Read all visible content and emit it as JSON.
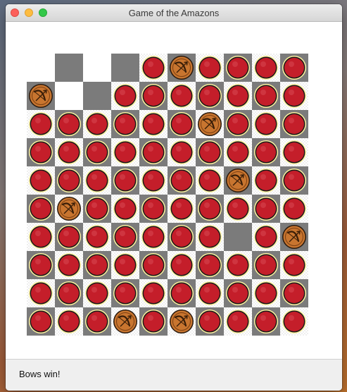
{
  "window": {
    "title": "Game of the Amazons"
  },
  "status": {
    "text": "Bows win!"
  },
  "board": {
    "size": 10,
    "legend": {
      "E": "empty",
      "A": "arrow-token",
      "B": "bow-piece"
    },
    "grid": [
      [
        "E",
        "E",
        "E",
        "E",
        "A",
        "B",
        "A",
        "A",
        "A",
        "A"
      ],
      [
        "B",
        "E",
        "E",
        "A",
        "A",
        "A",
        "A",
        "A",
        "A",
        "A"
      ],
      [
        "A",
        "A",
        "A",
        "A",
        "A",
        "A",
        "B",
        "A",
        "A",
        "A"
      ],
      [
        "A",
        "A",
        "A",
        "A",
        "A",
        "A",
        "A",
        "A",
        "A",
        "A"
      ],
      [
        "A",
        "A",
        "A",
        "A",
        "A",
        "A",
        "A",
        "B",
        "A",
        "A"
      ],
      [
        "A",
        "B",
        "A",
        "A",
        "A",
        "A",
        "A",
        "A",
        "A",
        "A"
      ],
      [
        "A",
        "A",
        "A",
        "A",
        "A",
        "A",
        "A",
        "E",
        "A",
        "B"
      ],
      [
        "A",
        "A",
        "A",
        "A",
        "A",
        "A",
        "A",
        "A",
        "A",
        "A"
      ],
      [
        "A",
        "A",
        "A",
        "A",
        "A",
        "A",
        "A",
        "A",
        "A",
        "A"
      ],
      [
        "A",
        "A",
        "A",
        "B",
        "A",
        "B",
        "A",
        "A",
        "A",
        "A"
      ]
    ],
    "colors": {
      "dark_square": "#7b7b7b",
      "light_square": "#ffffff",
      "arrow_token": "#c41e2a",
      "arrow_halo": "#fff3a0",
      "bow_piece": "#c8752f"
    }
  }
}
